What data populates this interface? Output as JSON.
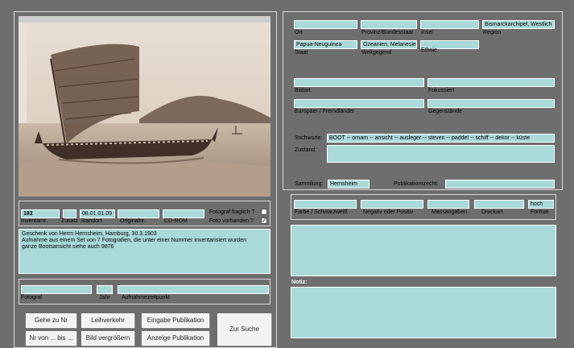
{
  "left": {
    "photo_alt": "Boot",
    "inventory": {
      "inv_nr": "182",
      "zusatz": "",
      "standort": "08.01.01.09",
      "originalnr": "",
      "cdrom": "",
      "labels": {
        "inv": "Inventarnr.",
        "zusatz": "Zusatz",
        "standort": "Standort",
        "originalnr": "Originalnr.",
        "cdrom": "CD-ROM"
      }
    },
    "fotograf_fraglich": {
      "label": "Fotograf fraglich ?",
      "checked": false
    },
    "foto_vorhanden": {
      "label": "Foto vorhanden ?",
      "checked": true
    },
    "description": "Geschenk von Herrn Hernsheim, Hamburg, 30.3.1903\nAufnahme aus einem Set von 7 Fotografien, die unter einer Nummer inventarisiert wurden\nganze Bootsansicht siehe auch 9876",
    "fotograf": {
      "value": "",
      "label": "Fotograf"
    },
    "jahr": {
      "value": "",
      "label": "Jahr"
    },
    "aufnahmezeitpunkt": {
      "value": "",
      "label": "Aufnahmezeitpunkt"
    },
    "buttons": {
      "gehe_zu_nr": "Gehe zu Nr",
      "nr_von_bis": "Nr von ... bis ...",
      "leihverkehr": "Leihverkehr",
      "bild_vergroessern": "Bild vergrößern",
      "eingabe_publikation": "Eingabe Publikation",
      "anzeige_publikation": "Anzeige Publikation",
      "zur_suche": "Zur Suche"
    }
  },
  "right": {
    "ort": {
      "value": "",
      "label": "Ort"
    },
    "provinz": {
      "value": "",
      "label": "Provinz/Bundesstaat"
    },
    "insel": {
      "value": "",
      "label": "Insel"
    },
    "region": {
      "value": "Bismarckarchipel, Westlich",
      "label": "Region"
    },
    "staat": {
      "value": "Papua-Neuguinea",
      "label": "Staat"
    },
    "weltgegend": {
      "value": "Ozeanien, Melanesie",
      "label": "Weltgegend"
    },
    "ethnie": {
      "value": "",
      "label": "Ethnie"
    },
    "bildart": {
      "value": "",
      "label": "Bildart"
    },
    "fokussiert": {
      "value": "",
      "label": "Fokussiert"
    },
    "europaeer": {
      "value": "",
      "label": "Europäer / Fremdländer"
    },
    "gegenstaende": {
      "value": "",
      "label": "Gegenstände"
    },
    "stichworte": {
      "label": "Stichworte:",
      "value": "BOOT -- ornam -- ansicht -- ausleger -- steven -- paddel -- schiff -- dekor -- küste"
    },
    "zustand": {
      "label": "Zustand:",
      "value": ""
    },
    "sammlung": {
      "label": "Sammlung:",
      "value": "Hernsheim"
    },
    "publikationsrecht": {
      "label": "Publikationsrecht:",
      "value": ""
    },
    "farbe": {
      "value": "",
      "label": "Farbe / Schwarzweiß"
    },
    "negativ": {
      "value": "",
      "label": "Negativ oder Positiv"
    },
    "massangaben": {
      "value": "",
      "label": "Massangaben"
    },
    "druckart": {
      "value": "",
      "label": "Druckart"
    },
    "format": {
      "value": "hoch",
      "label": "Format"
    },
    "notiz_label": "Notiz:"
  }
}
